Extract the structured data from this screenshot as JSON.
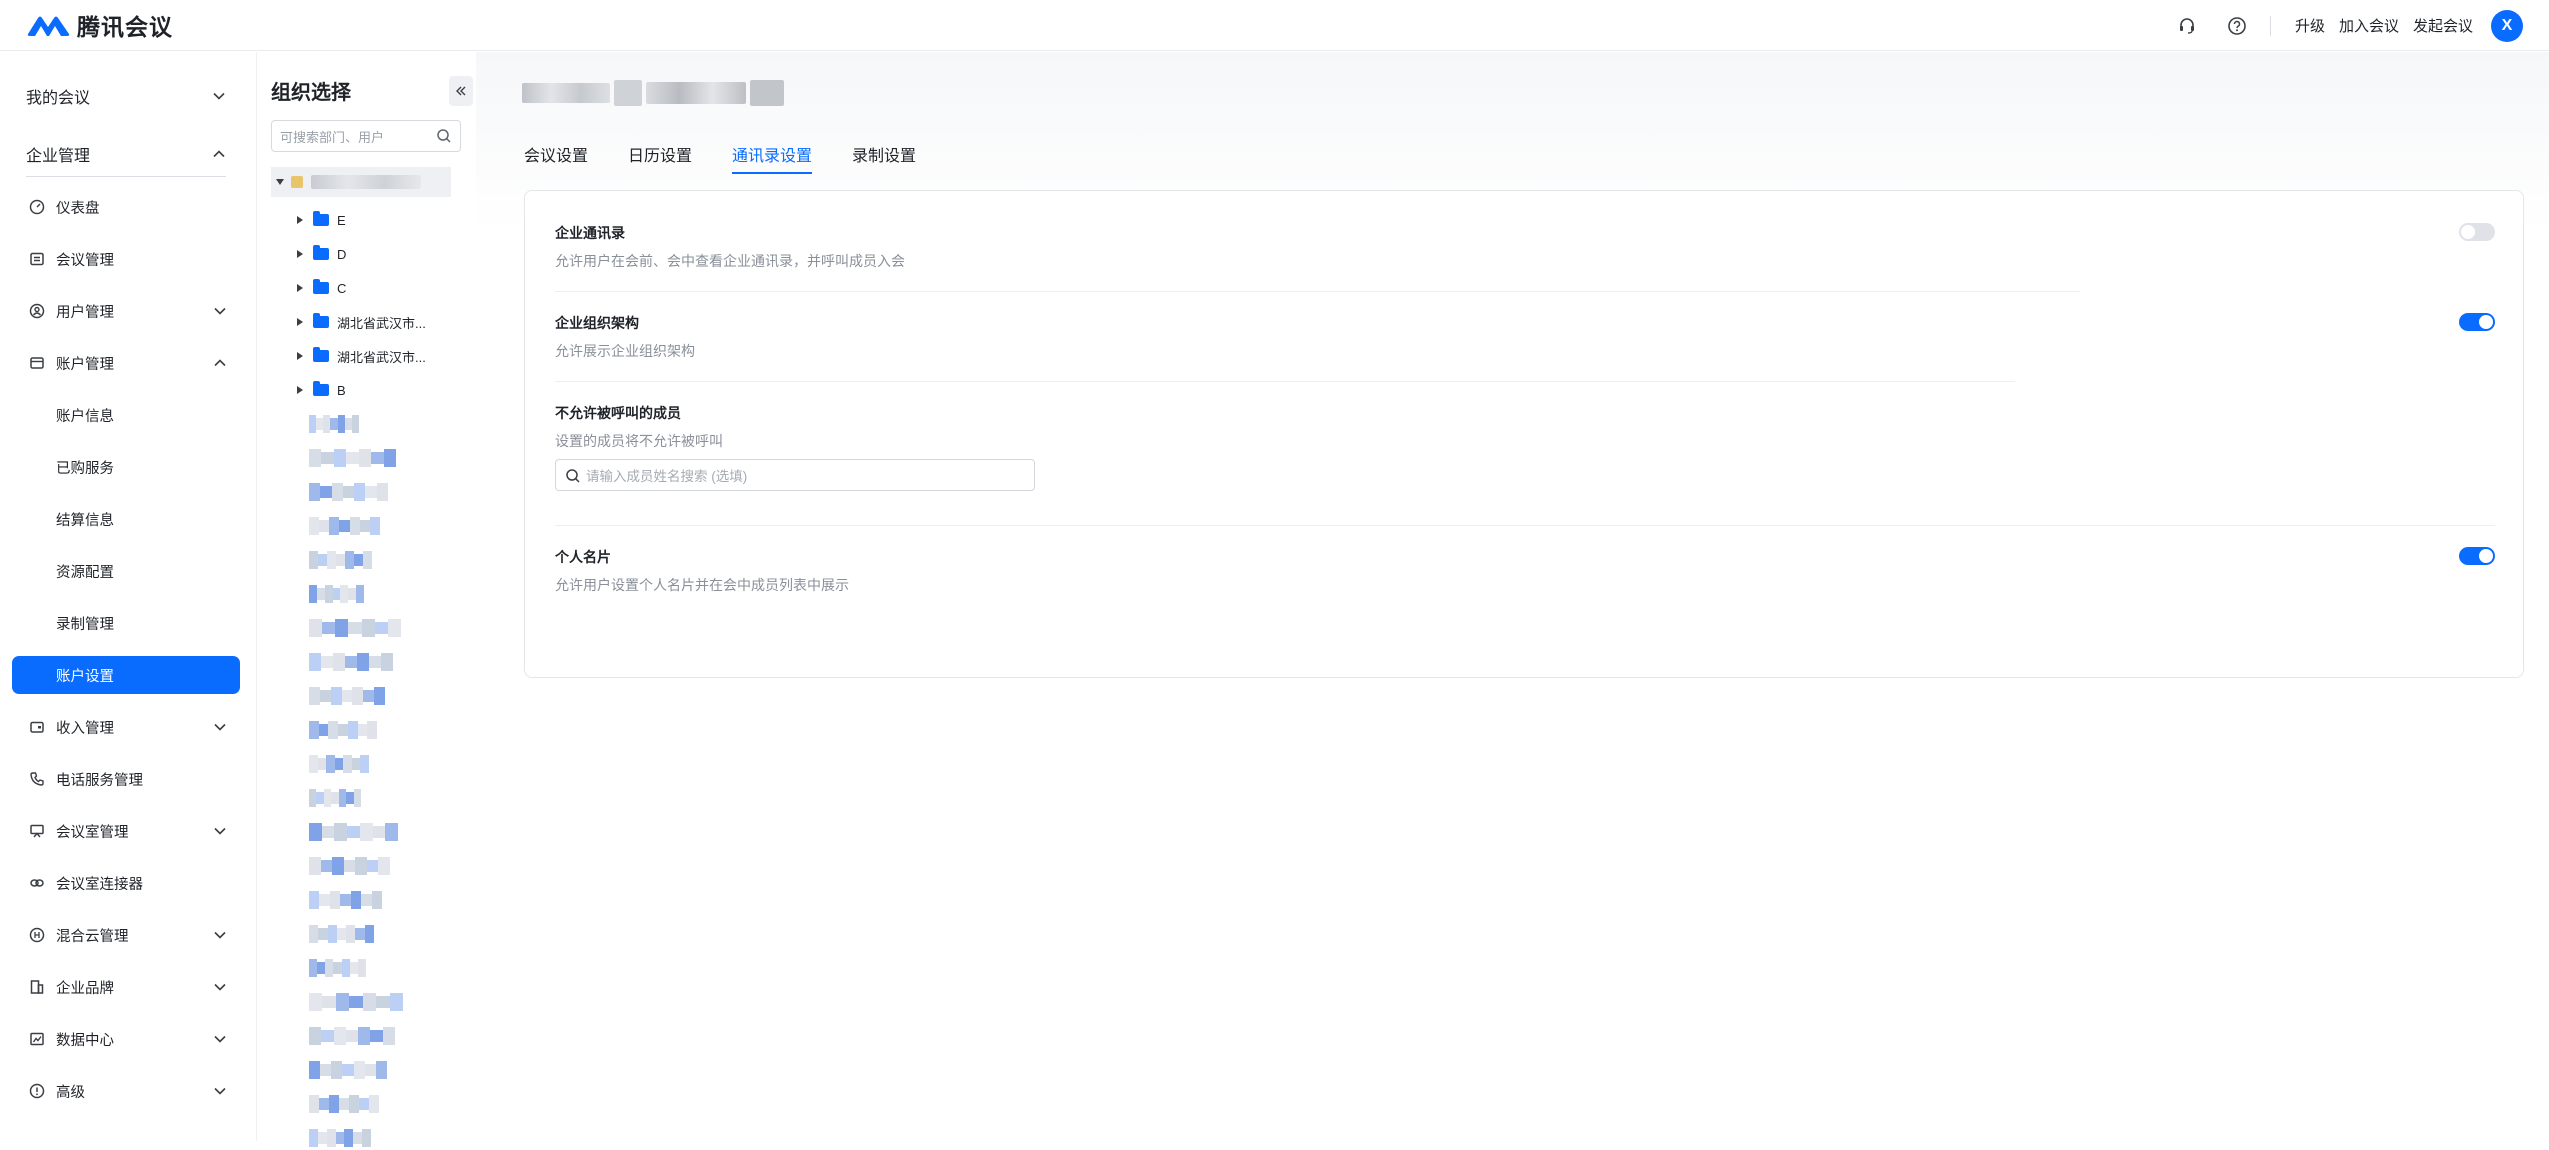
{
  "header": {
    "brand": "腾讯会议",
    "links": [
      "升级",
      "加入会议",
      "发起会议"
    ],
    "avatar_letter": "X",
    "icons": [
      "headset-icon",
      "help-icon"
    ]
  },
  "sidebar": {
    "my_meetings": "我的会议",
    "enterprise": "企业管理",
    "items": [
      {
        "label": "仪表盘",
        "icon": "dashboard-icon"
      },
      {
        "label": "会议管理",
        "icon": "list-icon"
      },
      {
        "label": "用户管理",
        "icon": "user-icon"
      },
      {
        "label": "账户管理",
        "icon": "account-icon"
      },
      {
        "label": "账户信息"
      },
      {
        "label": "已购服务"
      },
      {
        "label": "结算信息"
      },
      {
        "label": "资源配置"
      },
      {
        "label": "录制管理"
      },
      {
        "label": "账户设置"
      },
      {
        "label": "收入管理",
        "icon": "wallet-icon"
      },
      {
        "label": "电话服务管理",
        "icon": "phone-icon"
      },
      {
        "label": "会议室管理",
        "icon": "room-icon"
      },
      {
        "label": "会议室连接器",
        "icon": "link-icon"
      },
      {
        "label": "混合云管理",
        "icon": "cloud-icon"
      },
      {
        "label": "企业品牌",
        "icon": "building-icon"
      },
      {
        "label": "数据中心",
        "icon": "chart-icon"
      },
      {
        "label": "高级",
        "icon": "advanced-icon"
      }
    ]
  },
  "org": {
    "title": "组织选择",
    "search_placeholder": "可搜索部门、用户",
    "folders": [
      "E",
      "D",
      "C",
      "湖北省武汉市...",
      "湖北省武汉市...",
      "B"
    ]
  },
  "main": {
    "tabs": [
      "会议设置",
      "日历设置",
      "通讯录设置",
      "录制设置"
    ],
    "active_tab": "通讯录设置",
    "settings": {
      "directory_title": "企业通讯录",
      "directory_desc": "允许用户在会前、会中查看企业通讯录，并呼叫成员入会",
      "orgchart_title": "企业组织架构",
      "orgchart_desc": "允许展示企业组织架构",
      "nocall_title": "不允许被呼叫的成员",
      "nocall_desc": "设置的成员将不允许被呼叫",
      "nocall_placeholder": "请输入成员姓名搜索 (选填)",
      "card_title": "个人名片",
      "card_desc": "允许用户设置个人名片并在会中成员列表中展示"
    },
    "toggles": {
      "directory": false,
      "orgchart": true,
      "card": true
    }
  },
  "colors": {
    "accent": "#0a6cff"
  }
}
